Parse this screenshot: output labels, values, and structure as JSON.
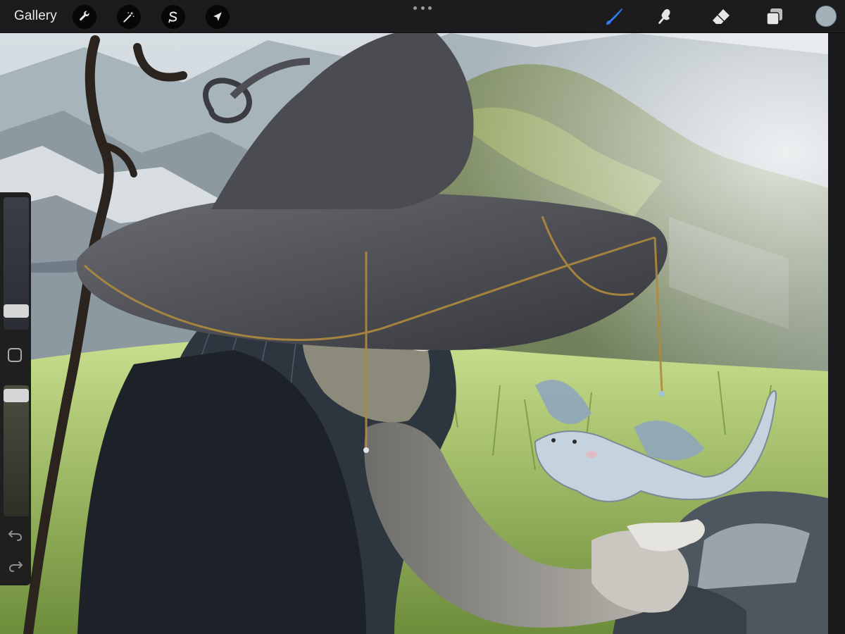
{
  "toolbar": {
    "gallery_label": "Gallery",
    "left_tools": [
      {
        "icon": "wrench-icon",
        "name": "actions"
      },
      {
        "icon": "magic-wand-icon",
        "name": "adjustments"
      },
      {
        "icon": "selection-icon",
        "name": "selection"
      },
      {
        "icon": "transform-arrow-icon",
        "name": "transform"
      }
    ],
    "right_tools": [
      {
        "icon": "brush-icon",
        "name": "paint",
        "active": true,
        "color": "#2f7cf6"
      },
      {
        "icon": "smudge-icon",
        "name": "smudge",
        "active": false
      },
      {
        "icon": "eraser-icon",
        "name": "eraser",
        "active": false
      },
      {
        "icon": "layers-icon",
        "name": "layers",
        "active": false
      }
    ],
    "current_color": "#a3b2b8"
  },
  "sidebar": {
    "brush_size_level": 0.1,
    "opacity_level": 0.97,
    "icons": [
      "modify-square-icon",
      "undo-icon",
      "redo-icon"
    ]
  },
  "canvas": {
    "colors": {
      "sky": "#c9d3d9",
      "mountain_far": "#9fabb3",
      "hill_green": "#7f9660",
      "grass": "#9fbf57",
      "hat": "#4a4c52",
      "hair": "#2e3640",
      "coat": "#1e2228",
      "sleeve": "#8b8a84",
      "dragon": "#c5d3de",
      "gold": "#b08a3e"
    }
  }
}
